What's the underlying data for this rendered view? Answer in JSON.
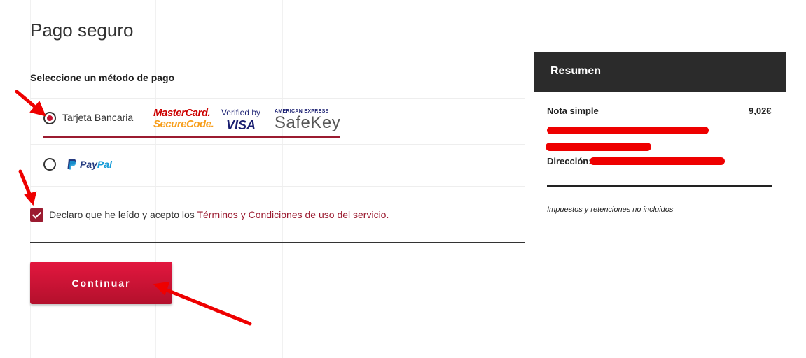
{
  "page": {
    "title": "Pago seguro"
  },
  "payment": {
    "heading": "Seleccione un método de pago",
    "options": [
      {
        "label": "Tarjeta Bancaria",
        "selected": true,
        "logos": {
          "mastercard_line1": "MasterCard.",
          "mastercard_line2": "SecureCode.",
          "visa_line1": "Verified by",
          "visa_line2": "VISA",
          "amex_line1": "AMERICAN EXPRESS",
          "amex_line2": "SafeKey"
        }
      },
      {
        "label_part1": "Pay",
        "label_part2": "Pal",
        "selected": false
      }
    ],
    "terms": {
      "checked": true,
      "text": "Declaro que he leído y acepto los",
      "link_text": "Términos y Condiciones de uso del servicio."
    },
    "continue_label": "Continuar"
  },
  "summary": {
    "title": "Resumen",
    "item_label": "Nota simple",
    "item_price": "9,02€",
    "address_label": "Dirección:",
    "note": "Impuestos y retenciones no incluidos"
  },
  "colors": {
    "accent": "#9b1b30",
    "button": "#d3163a",
    "summary_header": "#2b2b2b",
    "annotation_arrow": "#ee0000"
  },
  "icons": [
    "radio-checked",
    "radio-unchecked",
    "paypal-icon",
    "checkbox-checked",
    "arrow-annotation"
  ]
}
